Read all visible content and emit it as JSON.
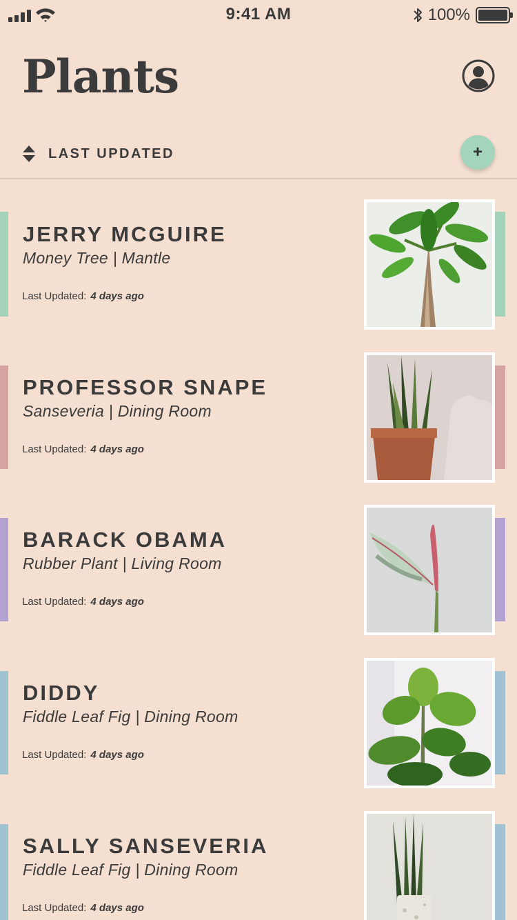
{
  "status_bar": {
    "time": "9:41 AM",
    "battery": "100%"
  },
  "header": {
    "title": "Plants",
    "profile_icon": "user-circle-icon"
  },
  "sort": {
    "label": "LAST UPDATED",
    "sort_icon": "sort-updown-icon",
    "add_label": "+"
  },
  "colors": {
    "background": "#f4dfd0",
    "text": "#3b3b3b",
    "add_button": "#a3d4bc"
  },
  "plants": [
    {
      "name": "JERRY MCGUIRE",
      "subtitle": "Money Tree | Mantle",
      "updated_label": "Last Updated:",
      "updated_value": "4 days ago",
      "accent": "#a3d2b8"
    },
    {
      "name": "PROFESSOR SNAPE",
      "subtitle": "Sanseveria | Dining Room",
      "updated_label": "Last Updated:",
      "updated_value": "4 days ago",
      "accent": "#d5a4a2"
    },
    {
      "name": "BARACK OBAMA",
      "subtitle": "Rubber Plant | Living Room",
      "updated_label": "Last Updated:",
      "updated_value": "4 days ago",
      "accent": "#b1a2cf"
    },
    {
      "name": "DIDDY",
      "subtitle": "Fiddle Leaf Fig | Dining Room",
      "updated_label": "Last Updated:",
      "updated_value": "4 days ago",
      "accent": "#a0c2d2"
    },
    {
      "name": "SALLY SANSEVERIA",
      "subtitle": "Fiddle Leaf Fig | Dining Room",
      "updated_label": "Last Updated:",
      "updated_value": "4 days ago",
      "accent": "#a0c2d2"
    }
  ]
}
